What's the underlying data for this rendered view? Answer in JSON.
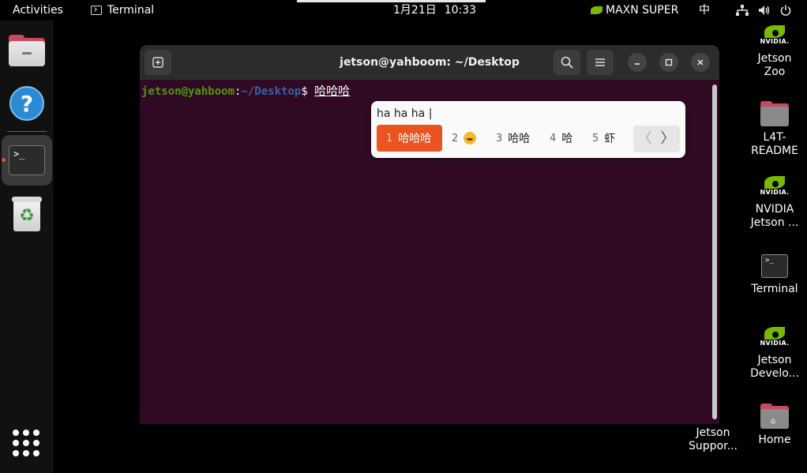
{
  "topbar": {
    "activities": "Activities",
    "app_name": "Terminal",
    "date": "1月21日",
    "time": "10:33",
    "power_mode": "MAXN SUPER",
    "input_method": "中"
  },
  "dock": {
    "items": [
      "files",
      "help",
      "terminal",
      "trash"
    ],
    "running_indicator_color": "#e95420"
  },
  "desktop": {
    "icons": [
      {
        "label_1": "Jetson",
        "label_2": "Zoo",
        "icon": "nvidia-icon"
      },
      {
        "label_1": "L4T-",
        "label_2": "README",
        "icon": "folder-icon"
      },
      {
        "label_1": "NVIDIA",
        "label_2": "Jetson ...",
        "icon": "nvidia-icon"
      },
      {
        "label_1": "Terminal",
        "label_2": "",
        "icon": "terminal-icon"
      },
      {
        "label_1": "Jetson",
        "label_2": "Develo...",
        "icon": "nvidia-icon"
      },
      {
        "label_1": "Jetson",
        "label_2": "Suppor...",
        "icon": "nvidia-icon"
      },
      {
        "label_1": "Home",
        "label_2": "",
        "icon": "home-folder-icon"
      }
    ]
  },
  "terminal": {
    "title": "jetson@yahboom: ~/Desktop",
    "prompt_user": "jetson@yahboom",
    "prompt_sep": ":",
    "prompt_path": "~/Desktop",
    "prompt_symbol": "$ ",
    "preedit": "哈哈哈",
    "bg_color": "#300a24"
  },
  "ime": {
    "input": "ha ha ha |",
    "candidates": [
      {
        "num": "1",
        "text": "哈哈哈",
        "selected": true
      },
      {
        "num": "2",
        "text": "",
        "emoji": "smiling-face-icon"
      },
      {
        "num": "3",
        "text": "哈哈"
      },
      {
        "num": "4",
        "text": "哈"
      },
      {
        "num": "5",
        "text": "虾"
      }
    ],
    "prev": "〈",
    "next": "〉",
    "accent_color": "#e95420"
  }
}
